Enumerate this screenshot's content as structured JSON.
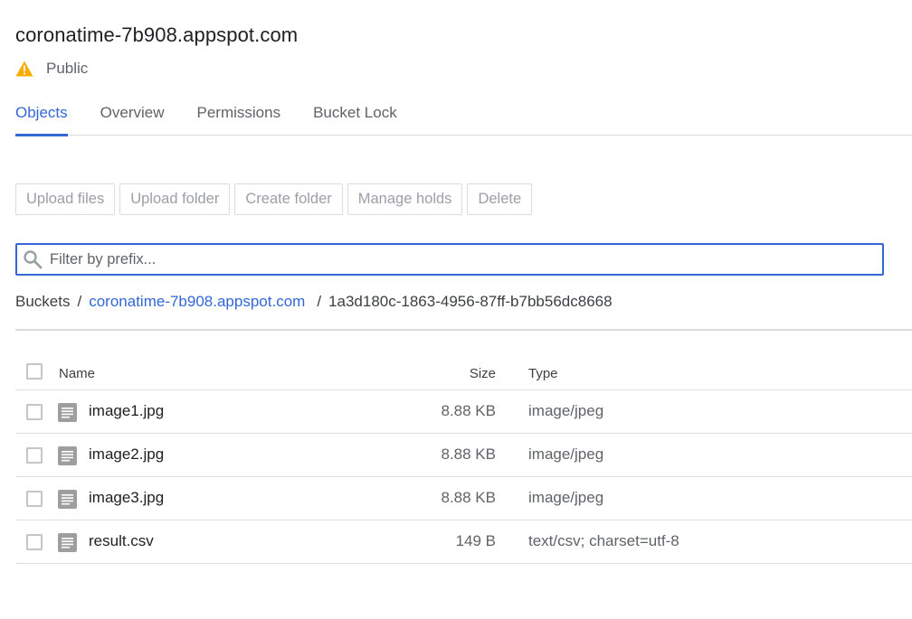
{
  "bucket": {
    "title": "coronatime-7b908.appspot.com",
    "visibility": "Public"
  },
  "tabs": [
    {
      "label": "Objects",
      "active": true
    },
    {
      "label": "Overview",
      "active": false
    },
    {
      "label": "Permissions",
      "active": false
    },
    {
      "label": "Bucket Lock",
      "active": false
    }
  ],
  "toolbar": {
    "upload_files": "Upload files",
    "upload_folder": "Upload folder",
    "create_folder": "Create folder",
    "manage_holds": "Manage holds",
    "delete": "Delete"
  },
  "filter": {
    "placeholder": "Filter by prefix..."
  },
  "breadcrumb": {
    "root": "Buckets",
    "separator": "/",
    "bucket": "coronatime-7b908.appspot.com",
    "folder": "1a3d180c-1863-4956-87ff-b7bb56dc8668"
  },
  "table": {
    "headers": {
      "name": "Name",
      "size": "Size",
      "type": "Type"
    },
    "rows": [
      {
        "name": "image1.jpg",
        "size": "8.88 KB",
        "type": "image/jpeg"
      },
      {
        "name": "image2.jpg",
        "size": "8.88 KB",
        "type": "image/jpeg"
      },
      {
        "name": "image3.jpg",
        "size": "8.88 KB",
        "type": "image/jpeg"
      },
      {
        "name": "result.csv",
        "size": "149 B",
        "type": "text/csv; charset=utf-8"
      }
    ]
  },
  "colors": {
    "accent": "#3367d6",
    "warning": "#f9ab00",
    "file_icon": "#9e9e9e"
  },
  "icons": {
    "visibility": "warning-icon",
    "filter": "search-icon",
    "file": "file-document-icon"
  }
}
